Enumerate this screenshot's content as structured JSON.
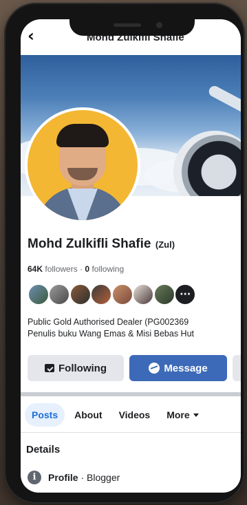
{
  "header": {
    "title": "Mohd Zulkifli Shafie"
  },
  "profile": {
    "name": "Mohd Zulkifli Shafie",
    "nickname": "(Zul)",
    "followers_count": "64K",
    "followers_label": "followers",
    "separator": "·",
    "following_count": "0",
    "following_label": "following",
    "bio_line1": "Public Gold Authorised Dealer (PG002369",
    "bio_line2": "Penulis buku Wang Emas & Misi Bebas Hut"
  },
  "friends_more_glyph": "···",
  "actions": {
    "following_label": "Following",
    "message_label": "Message"
  },
  "tabs": [
    {
      "label": "Posts",
      "active": true
    },
    {
      "label": "About",
      "active": false
    },
    {
      "label": "Videos",
      "active": false
    },
    {
      "label": "More",
      "active": false
    }
  ],
  "details": {
    "title": "Details",
    "profile_label": "Profile",
    "profile_separator": "·",
    "profile_value": "Blogger"
  },
  "colors": {
    "accent": "#1b6fd8",
    "message_button": "#3d6ab8",
    "avatar_background": "#f3b734"
  }
}
